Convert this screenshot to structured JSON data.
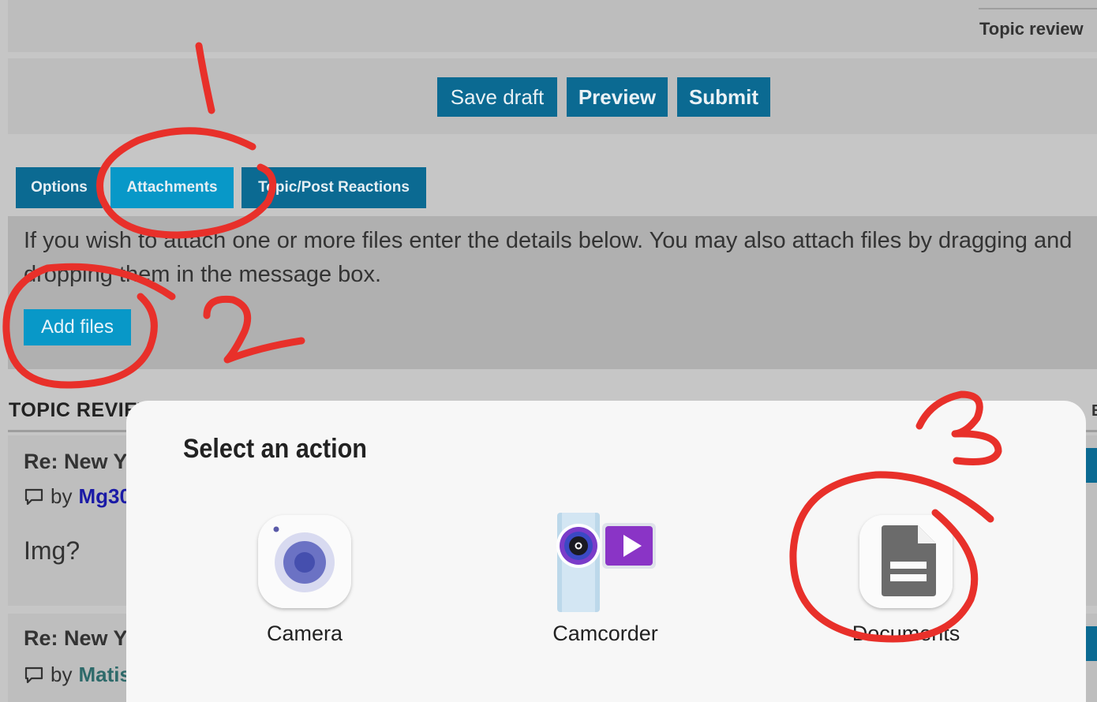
{
  "header": {
    "topic_review_link": "Topic review"
  },
  "actions": {
    "save_draft": "Save draft",
    "preview": "Preview",
    "submit": "Submit"
  },
  "tabs": [
    {
      "label": "Options",
      "active": false
    },
    {
      "label": "Attachments",
      "active": true
    },
    {
      "label": "Topic/Post Reactions",
      "active": false
    }
  ],
  "attachments": {
    "instructions_line1": "If you wish to attach one or more files enter the details below. You may also attach files by dragging and",
    "instructions_line2": "dropping them in the message box.",
    "add_files_label": "Add files"
  },
  "topic_review": {
    "heading": "TOPIC REVIEW",
    "right_edge_text": "E",
    "posts": [
      {
        "title": "Re: New Y",
        "by_label": "by",
        "author": "Mg30",
        "author_color": "#1a1aa6",
        "body": "Img?"
      },
      {
        "title": "Re: New Y",
        "by_label": "by",
        "author": "Matis",
        "author_color": "#2e6a6a",
        "body": ""
      }
    ]
  },
  "dialog": {
    "title": "Select an action",
    "apps": [
      {
        "label": "Camera",
        "icon": "camera-icon"
      },
      {
        "label": "Camcorder",
        "icon": "camcorder-icon"
      },
      {
        "label": "Documents",
        "icon": "documents-icon"
      }
    ]
  },
  "annotations": {
    "numbers": [
      "1",
      "2",
      "3"
    ],
    "color": "#e8302a"
  },
  "colors": {
    "primary_button": "#0b6a92",
    "active_tab": "#0898c8",
    "annotation_red": "#e8302a"
  }
}
